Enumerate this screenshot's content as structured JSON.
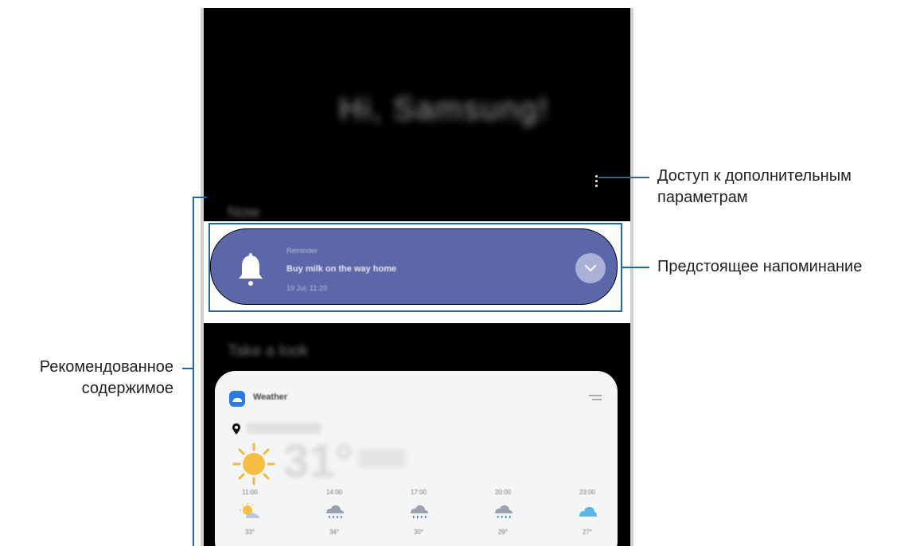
{
  "screen": {
    "greeting": "Hi, Samsung!",
    "section_now": "Now",
    "section_look": "Take a look"
  },
  "reminder": {
    "label": "Reminder",
    "title": "Buy milk on the way home",
    "time": "19 Jul, 11:20",
    "card_color": "#5b67a8"
  },
  "weather": {
    "app_name": "Weather",
    "temperature": "31°",
    "forecast": [
      {
        "time": "11:00",
        "icon": "partly-sunny-icon",
        "temp": "33°"
      },
      {
        "time": "14:00",
        "icon": "rain-cloud-icon",
        "temp": "34°"
      },
      {
        "time": "17:00",
        "icon": "rain-cloud-icon",
        "temp": "30°"
      },
      {
        "time": "20:00",
        "icon": "rain-cloud-icon",
        "temp": "29°"
      },
      {
        "time": "23:00",
        "icon": "cloud-icon",
        "temp": "27°"
      }
    ]
  },
  "callouts": {
    "more_options": [
      "Доступ к дополнительным",
      "параметрам"
    ],
    "upcoming_reminder": "Предстоящее напоминание",
    "recommended": [
      "Рекомендованное",
      "содержимое"
    ],
    "line_color": "#1c6aa6"
  }
}
